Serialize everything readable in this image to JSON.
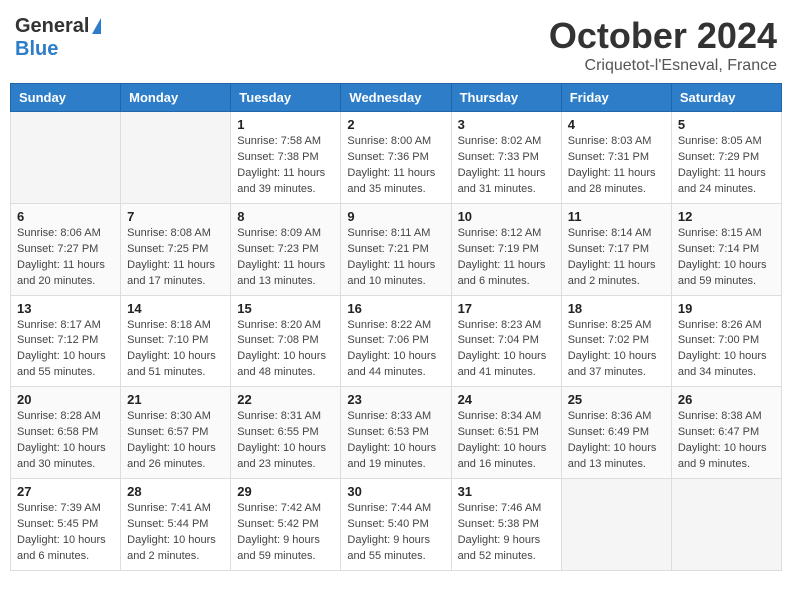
{
  "header": {
    "logo_general": "General",
    "logo_blue": "Blue",
    "month_title": "October 2024",
    "location": "Criquetot-l'Esneval, France"
  },
  "days_of_week": [
    "Sunday",
    "Monday",
    "Tuesday",
    "Wednesday",
    "Thursday",
    "Friday",
    "Saturday"
  ],
  "weeks": [
    [
      {
        "day": "",
        "info": ""
      },
      {
        "day": "",
        "info": ""
      },
      {
        "day": "1",
        "info": "Sunrise: 7:58 AM\nSunset: 7:38 PM\nDaylight: 11 hours and 39 minutes."
      },
      {
        "day": "2",
        "info": "Sunrise: 8:00 AM\nSunset: 7:36 PM\nDaylight: 11 hours and 35 minutes."
      },
      {
        "day": "3",
        "info": "Sunrise: 8:02 AM\nSunset: 7:33 PM\nDaylight: 11 hours and 31 minutes."
      },
      {
        "day": "4",
        "info": "Sunrise: 8:03 AM\nSunset: 7:31 PM\nDaylight: 11 hours and 28 minutes."
      },
      {
        "day": "5",
        "info": "Sunrise: 8:05 AM\nSunset: 7:29 PM\nDaylight: 11 hours and 24 minutes."
      }
    ],
    [
      {
        "day": "6",
        "info": "Sunrise: 8:06 AM\nSunset: 7:27 PM\nDaylight: 11 hours and 20 minutes."
      },
      {
        "day": "7",
        "info": "Sunrise: 8:08 AM\nSunset: 7:25 PM\nDaylight: 11 hours and 17 minutes."
      },
      {
        "day": "8",
        "info": "Sunrise: 8:09 AM\nSunset: 7:23 PM\nDaylight: 11 hours and 13 minutes."
      },
      {
        "day": "9",
        "info": "Sunrise: 8:11 AM\nSunset: 7:21 PM\nDaylight: 11 hours and 10 minutes."
      },
      {
        "day": "10",
        "info": "Sunrise: 8:12 AM\nSunset: 7:19 PM\nDaylight: 11 hours and 6 minutes."
      },
      {
        "day": "11",
        "info": "Sunrise: 8:14 AM\nSunset: 7:17 PM\nDaylight: 11 hours and 2 minutes."
      },
      {
        "day": "12",
        "info": "Sunrise: 8:15 AM\nSunset: 7:14 PM\nDaylight: 10 hours and 59 minutes."
      }
    ],
    [
      {
        "day": "13",
        "info": "Sunrise: 8:17 AM\nSunset: 7:12 PM\nDaylight: 10 hours and 55 minutes."
      },
      {
        "day": "14",
        "info": "Sunrise: 8:18 AM\nSunset: 7:10 PM\nDaylight: 10 hours and 51 minutes."
      },
      {
        "day": "15",
        "info": "Sunrise: 8:20 AM\nSunset: 7:08 PM\nDaylight: 10 hours and 48 minutes."
      },
      {
        "day": "16",
        "info": "Sunrise: 8:22 AM\nSunset: 7:06 PM\nDaylight: 10 hours and 44 minutes."
      },
      {
        "day": "17",
        "info": "Sunrise: 8:23 AM\nSunset: 7:04 PM\nDaylight: 10 hours and 41 minutes."
      },
      {
        "day": "18",
        "info": "Sunrise: 8:25 AM\nSunset: 7:02 PM\nDaylight: 10 hours and 37 minutes."
      },
      {
        "day": "19",
        "info": "Sunrise: 8:26 AM\nSunset: 7:00 PM\nDaylight: 10 hours and 34 minutes."
      }
    ],
    [
      {
        "day": "20",
        "info": "Sunrise: 8:28 AM\nSunset: 6:58 PM\nDaylight: 10 hours and 30 minutes."
      },
      {
        "day": "21",
        "info": "Sunrise: 8:30 AM\nSunset: 6:57 PM\nDaylight: 10 hours and 26 minutes."
      },
      {
        "day": "22",
        "info": "Sunrise: 8:31 AM\nSunset: 6:55 PM\nDaylight: 10 hours and 23 minutes."
      },
      {
        "day": "23",
        "info": "Sunrise: 8:33 AM\nSunset: 6:53 PM\nDaylight: 10 hours and 19 minutes."
      },
      {
        "day": "24",
        "info": "Sunrise: 8:34 AM\nSunset: 6:51 PM\nDaylight: 10 hours and 16 minutes."
      },
      {
        "day": "25",
        "info": "Sunrise: 8:36 AM\nSunset: 6:49 PM\nDaylight: 10 hours and 13 minutes."
      },
      {
        "day": "26",
        "info": "Sunrise: 8:38 AM\nSunset: 6:47 PM\nDaylight: 10 hours and 9 minutes."
      }
    ],
    [
      {
        "day": "27",
        "info": "Sunrise: 7:39 AM\nSunset: 5:45 PM\nDaylight: 10 hours and 6 minutes."
      },
      {
        "day": "28",
        "info": "Sunrise: 7:41 AM\nSunset: 5:44 PM\nDaylight: 10 hours and 2 minutes."
      },
      {
        "day": "29",
        "info": "Sunrise: 7:42 AM\nSunset: 5:42 PM\nDaylight: 9 hours and 59 minutes."
      },
      {
        "day": "30",
        "info": "Sunrise: 7:44 AM\nSunset: 5:40 PM\nDaylight: 9 hours and 55 minutes."
      },
      {
        "day": "31",
        "info": "Sunrise: 7:46 AM\nSunset: 5:38 PM\nDaylight: 9 hours and 52 minutes."
      },
      {
        "day": "",
        "info": ""
      },
      {
        "day": "",
        "info": ""
      }
    ]
  ]
}
